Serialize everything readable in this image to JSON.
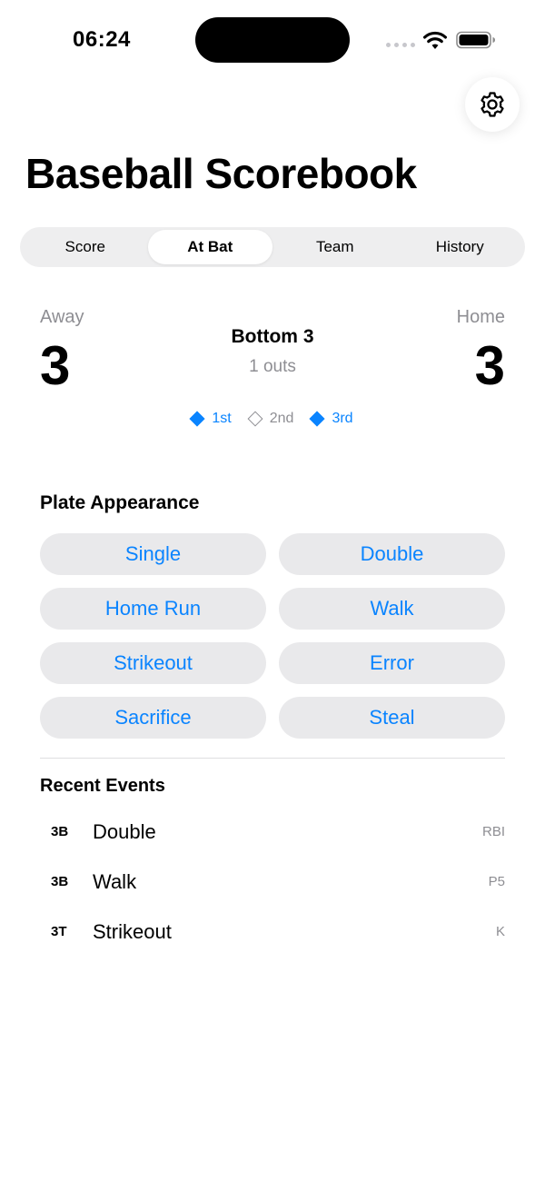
{
  "status_bar": {
    "time": "06:24"
  },
  "app": {
    "title": "Baseball Scorebook",
    "settings_icon": "gear-icon"
  },
  "tabs": [
    {
      "label": "Score",
      "active": false
    },
    {
      "label": "At Bat",
      "active": true
    },
    {
      "label": "Team",
      "active": false
    },
    {
      "label": "History",
      "active": false
    }
  ],
  "scoreboard": {
    "away_label": "Away",
    "away_score": "3",
    "home_label": "Home",
    "home_score": "3",
    "inning": "Bottom 3",
    "outs": "1 outs",
    "bases": [
      {
        "label": "1st",
        "occupied": true
      },
      {
        "label": "2nd",
        "occupied": false
      },
      {
        "label": "3rd",
        "occupied": true
      }
    ]
  },
  "plate_appearance": {
    "title": "Plate Appearance",
    "buttons": [
      "Single",
      "Double",
      "Home Run",
      "Walk",
      "Strikeout",
      "Error",
      "Sacrifice",
      "Steal"
    ]
  },
  "recent_events": {
    "title": "Recent Events",
    "items": [
      {
        "inning": "3B",
        "event": "Double",
        "note": "RBI"
      },
      {
        "inning": "3B",
        "event": "Walk",
        "note": "P5"
      },
      {
        "inning": "3T",
        "event": "Strikeout",
        "note": "K"
      }
    ]
  },
  "colors": {
    "accent": "#0a84ff",
    "secondary_text": "#8e8e93",
    "button_background": "#e9e9eb",
    "segmented_background": "#eeeeef"
  }
}
